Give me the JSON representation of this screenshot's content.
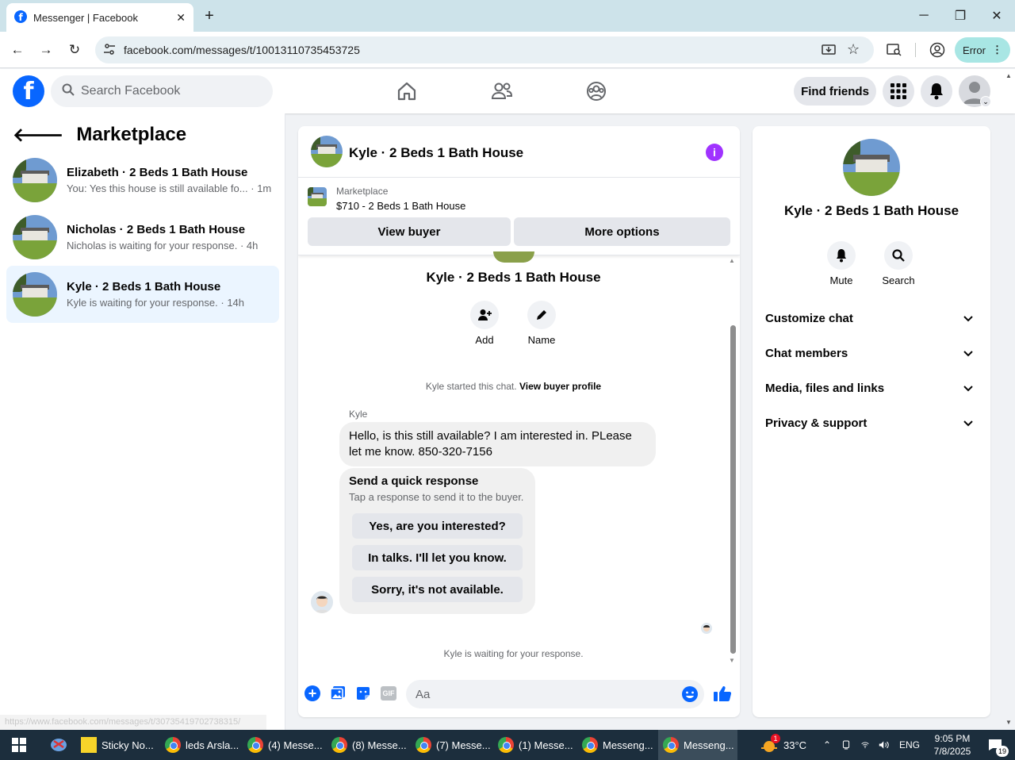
{
  "browser": {
    "tab_title": "Messenger | Facebook",
    "url": "facebook.com/messages/t/10013110735453725",
    "error_label": "Error"
  },
  "fb": {
    "search_placeholder": "Search Facebook",
    "find_friends": "Find friends"
  },
  "left": {
    "title": "Marketplace",
    "conversations": [
      {
        "name": "Elizabeth · 2 Beds 1 Bath House",
        "preview": "You: Yes this house is still available fo...",
        "time": "· 1m"
      },
      {
        "name": "Nicholas · 2 Beds 1 Bath House",
        "preview": "Nicholas is waiting for your response.",
        "time": "· 4h"
      },
      {
        "name": "Kyle · 2 Beds 1 Bath House",
        "preview": "Kyle is waiting for your response.",
        "time": "· 14h"
      }
    ],
    "status_url": "https://www.facebook.com/messages/t/30735419702738315/"
  },
  "chat": {
    "header_title": "Kyle · 2 Beds 1 Bath House",
    "listing_source": "Marketplace",
    "listing_title": "$710 - 2 Beds 1 Bath House",
    "view_buyer": "View buyer",
    "more_options": "More options",
    "profile_name": "Kyle · 2 Beds 1 Bath House",
    "add_label": "Add",
    "name_label": "Name",
    "started_text": "Kyle started this chat.",
    "view_buyer_profile": "View buyer profile",
    "sender": "Kyle",
    "message": "Hello, is this still available? I am interested in. PLease let me know.  850-320-7156",
    "quick_title": "Send a quick response",
    "quick_sub": "Tap a response to send it to the buyer.",
    "quick_replies": [
      "Yes, are you interested?",
      "In talks. I'll let you know.",
      "Sorry, it's not available."
    ],
    "waiting_text": "Kyle is waiting for your response.",
    "input_placeholder": "Aa"
  },
  "right": {
    "name": "Kyle · 2 Beds 1 Bath House",
    "mute": "Mute",
    "search": "Search",
    "sections": [
      "Customize chat",
      "Chat members",
      "Media, files and links",
      "Privacy & support"
    ]
  },
  "taskbar": {
    "items": [
      "Sticky No...",
      "leds Arsla...",
      "(4) Messe...",
      "(8) Messe...",
      "(7) Messe...",
      "(1) Messe...",
      "Messeng...",
      "Messeng..."
    ],
    "temperature": "33°C",
    "language": "ENG",
    "time": "9:05 PM",
    "date": "7/8/2025",
    "notification_count": "19",
    "weather_badge": "1"
  },
  "colors": {
    "accent": "#0866ff",
    "info": "#a033ff",
    "taskbar": "#1c2e3d"
  }
}
